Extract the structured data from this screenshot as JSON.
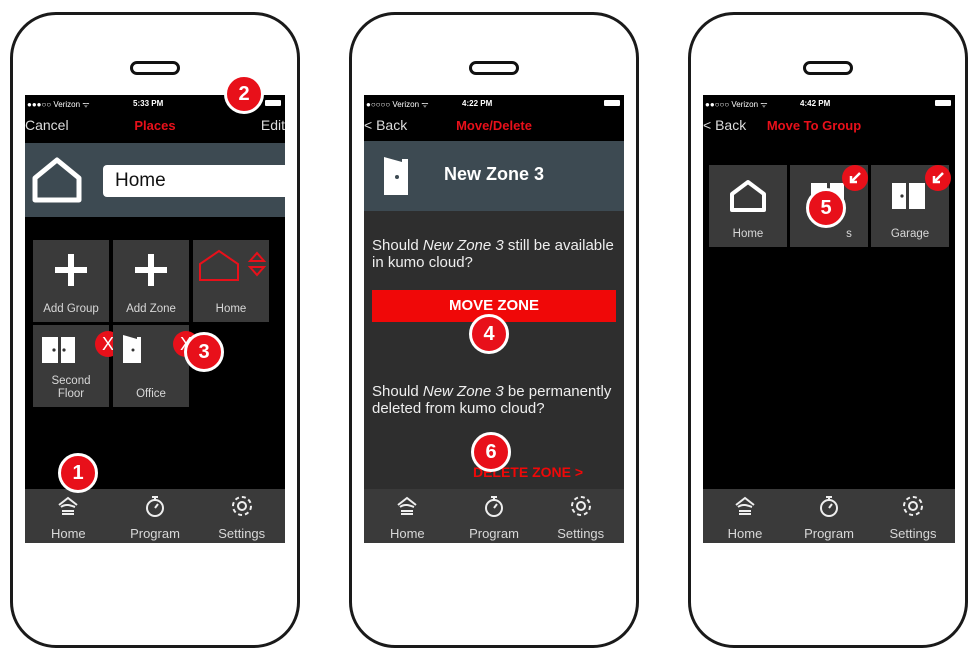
{
  "phone1": {
    "status": {
      "carrier": "●●●○○ Verizon ᯤ",
      "time": "5:33 PM"
    },
    "nav": {
      "left": "Cancel",
      "title": "Places",
      "right": "Edit"
    },
    "name_input_value": "Home",
    "tiles": [
      {
        "label": "Add Group",
        "icon": "plus-icon"
      },
      {
        "label": "Add Zone",
        "icon": "plus-icon"
      },
      {
        "label": "Home",
        "icon": "house-outline-icon"
      },
      {
        "label": "Second\nFloor",
        "icon": "double-door-icon"
      },
      {
        "label": "Office",
        "icon": "door-icon"
      }
    ],
    "delete_mark": "X"
  },
  "phone2": {
    "status": {
      "carrier": "●○○○○ Verizon ᯤ",
      "time": "4:22 PM"
    },
    "nav": {
      "left": "< Back",
      "title": "Move/Delete"
    },
    "zone_name": "New Zone 3",
    "question1": {
      "pre": "Should ",
      "zone": "New Zone 3",
      "post": " still be available in kumo cloud?"
    },
    "move_button": "MOVE ZONE",
    "question2": {
      "pre": "Should ",
      "zone": "New Zone 3",
      "post": " be permanently deleted from kumo cloud?"
    },
    "delete_button": "DELETE ZONE  >"
  },
  "phone3": {
    "status": {
      "carrier": "●●○○○ Verizon ᯤ",
      "time": "4:42 PM"
    },
    "nav": {
      "left": "< Back",
      "title": "Move To Group"
    },
    "tiles": [
      {
        "label": "Home",
        "icon": "house-outline-icon"
      },
      {
        "label": "s",
        "icon": "double-door-icon"
      },
      {
        "label": "Garage",
        "icon": "door-icon"
      }
    ]
  },
  "tabbar": {
    "home": "Home",
    "program": "Program",
    "settings": "Settings"
  },
  "callouts": [
    "1",
    "2",
    "3",
    "4",
    "5",
    "6"
  ],
  "colors": {
    "accent": "#e8101a",
    "tile": "#3a3a3a",
    "header": "#3d4a52",
    "panel": "#2e2e2e"
  }
}
